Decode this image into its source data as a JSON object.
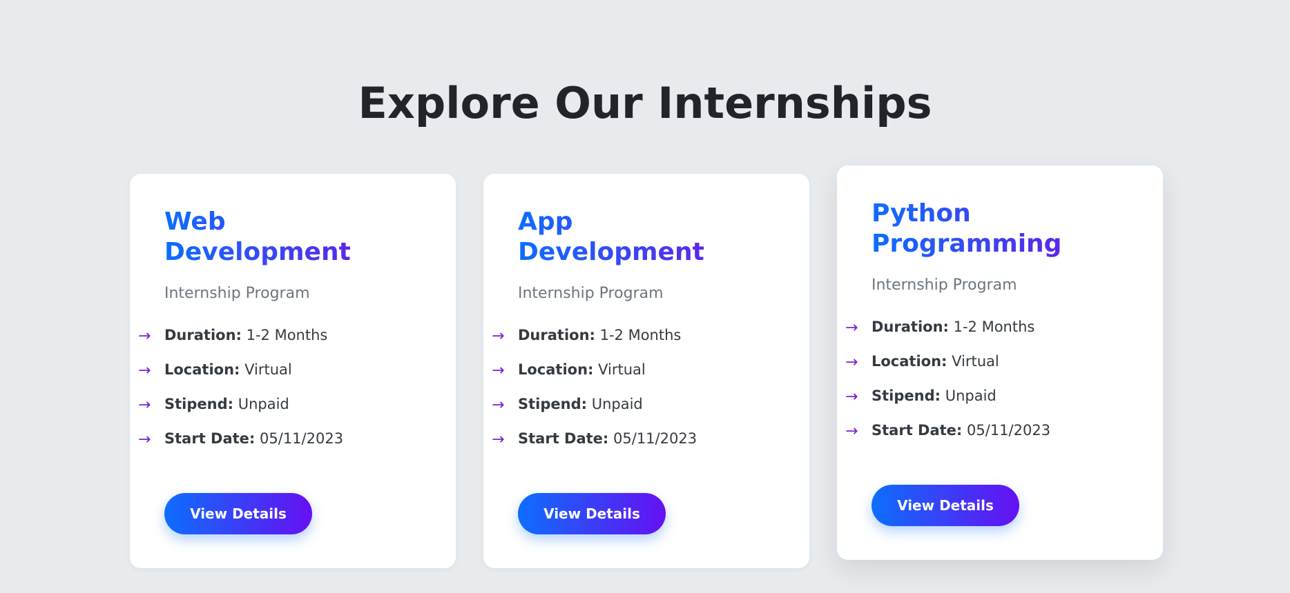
{
  "page": {
    "title": "Explore Our Internships"
  },
  "colors": {
    "background": "#e8ebee",
    "card": "#ffffff",
    "gradient_start": "#0d6efd",
    "gradient_end": "#6610f2",
    "arrow": "#7a1fd6",
    "heading_text": "#212529",
    "subtitle_text": "#6c757d"
  },
  "icons": {
    "bullet": "right-arrow-icon",
    "bullet_glyph": "→"
  },
  "cards": [
    {
      "title": "Web Development",
      "subtitle": "Internship Program",
      "details": [
        {
          "label": "Duration:",
          "value": "1-2 Months"
        },
        {
          "label": "Location:",
          "value": "Virtual"
        },
        {
          "label": "Stipend:",
          "value": "Unpaid"
        },
        {
          "label": "Start Date:",
          "value": "05/11/2023"
        }
      ],
      "button_label": "View Details"
    },
    {
      "title": "App Development",
      "subtitle": "Internship Program",
      "details": [
        {
          "label": "Duration:",
          "value": "1-2 Months"
        },
        {
          "label": "Location:",
          "value": "Virtual"
        },
        {
          "label": "Stipend:",
          "value": "Unpaid"
        },
        {
          "label": "Start Date:",
          "value": "05/11/2023"
        }
      ],
      "button_label": "View Details"
    },
    {
      "title": "Python Programming",
      "subtitle": "Internship Program",
      "details": [
        {
          "label": "Duration:",
          "value": "1-2 Months"
        },
        {
          "label": "Location:",
          "value": "Virtual"
        },
        {
          "label": "Stipend:",
          "value": "Unpaid"
        },
        {
          "label": "Start Date:",
          "value": "05/11/2023"
        }
      ],
      "button_label": "View Details"
    }
  ]
}
